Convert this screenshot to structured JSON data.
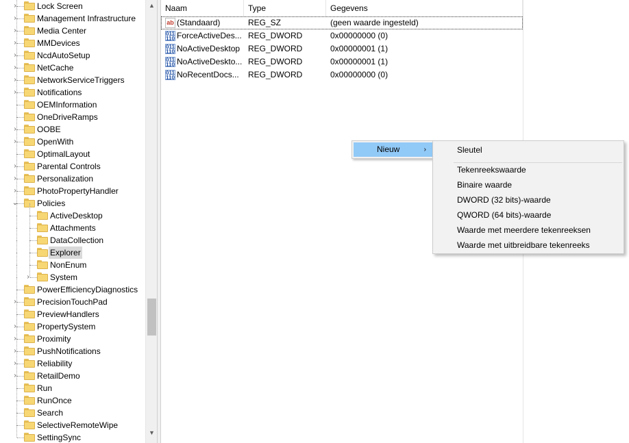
{
  "tree": {
    "items": [
      {
        "label": "Lock Screen",
        "expander": "›",
        "depth": 0
      },
      {
        "label": "Management Infrastructure",
        "expander": "›",
        "depth": 0
      },
      {
        "label": "Media Center",
        "expander": "›",
        "depth": 0
      },
      {
        "label": "MMDevices",
        "expander": "›",
        "depth": 0
      },
      {
        "label": "NcdAutoSetup",
        "expander": "›",
        "depth": 0
      },
      {
        "label": "NetCache",
        "expander": "›",
        "depth": 0
      },
      {
        "label": "NetworkServiceTriggers",
        "expander": "›",
        "depth": 0
      },
      {
        "label": "Notifications",
        "expander": "›",
        "depth": 0
      },
      {
        "label": "OEMInformation",
        "expander": "",
        "depth": 0
      },
      {
        "label": "OneDriveRamps",
        "expander": "",
        "depth": 0
      },
      {
        "label": "OOBE",
        "expander": "›",
        "depth": 0
      },
      {
        "label": "OpenWith",
        "expander": "›",
        "depth": 0
      },
      {
        "label": "OptimalLayout",
        "expander": "",
        "depth": 0
      },
      {
        "label": "Parental Controls",
        "expander": "›",
        "depth": 0
      },
      {
        "label": "Personalization",
        "expander": "›",
        "depth": 0
      },
      {
        "label": "PhotoPropertyHandler",
        "expander": "›",
        "depth": 0
      },
      {
        "label": "Policies",
        "expander": "⌄",
        "depth": 0
      },
      {
        "label": "ActiveDesktop",
        "expander": "",
        "depth": 1
      },
      {
        "label": "Attachments",
        "expander": "",
        "depth": 1
      },
      {
        "label": "DataCollection",
        "expander": "",
        "depth": 1
      },
      {
        "label": "Explorer",
        "expander": "",
        "depth": 1
      },
      {
        "label": "NonEnum",
        "expander": "",
        "depth": 1
      },
      {
        "label": "System",
        "expander": "›",
        "depth": 1
      },
      {
        "label": "PowerEfficiencyDiagnostics",
        "expander": "",
        "depth": 0
      },
      {
        "label": "PrecisionTouchPad",
        "expander": "›",
        "depth": 0
      },
      {
        "label": "PreviewHandlers",
        "expander": "",
        "depth": 0
      },
      {
        "label": "PropertySystem",
        "expander": "›",
        "depth": 0
      },
      {
        "label": "Proximity",
        "expander": "›",
        "depth": 0
      },
      {
        "label": "PushNotifications",
        "expander": "›",
        "depth": 0
      },
      {
        "label": "Reliability",
        "expander": "›",
        "depth": 0
      },
      {
        "label": "RetailDemo",
        "expander": "›",
        "depth": 0
      },
      {
        "label": "Run",
        "expander": "",
        "depth": 0
      },
      {
        "label": "RunOnce",
        "expander": "",
        "depth": 0
      },
      {
        "label": "Search",
        "expander": "",
        "depth": 0
      },
      {
        "label": "SelectiveRemoteWipe",
        "expander": "",
        "depth": 0
      },
      {
        "label": "SettingSync",
        "expander": "",
        "depth": 0
      }
    ],
    "selected_label": "Explorer",
    "scrollbar": {
      "up_arrow": "▲",
      "down_arrow": "▼"
    }
  },
  "values": {
    "columns": [
      "Naam",
      "Type",
      "Gegevens"
    ],
    "rows": [
      {
        "name": "(Standaard)",
        "type": "REG_SZ",
        "data": "(geen waarde ingesteld)",
        "icon": "string-value-icon",
        "glyph": "ab"
      },
      {
        "name": "ForceActiveDes...",
        "type": "REG_DWORD",
        "data": "0x00000000 (0)",
        "icon": "binary-value-icon",
        "glyph": "011 110"
      },
      {
        "name": "NoActiveDesktop",
        "type": "REG_DWORD",
        "data": "0x00000001 (1)",
        "icon": "binary-value-icon",
        "glyph": "011 110"
      },
      {
        "name": "NoActiveDeskto...",
        "type": "REG_DWORD",
        "data": "0x00000001 (1)",
        "icon": "binary-value-icon",
        "glyph": "011 110"
      },
      {
        "name": "NoRecentDocs...",
        "type": "REG_DWORD",
        "data": "0x00000000 (0)",
        "icon": "binary-value-icon",
        "glyph": "011 110"
      }
    ]
  },
  "context_menu": {
    "new_label": "Nieuw",
    "new_chevron": "›",
    "submenu": {
      "key_label": "Sleutel",
      "items": [
        "Tekenreekswaarde",
        "Binaire waarde",
        "DWORD (32 bits)-waarde",
        "QWORD (64 bits)-waarde",
        "Waarde met meerdere tekenreeksen",
        "Waarde met uitbreidbare tekenreeks"
      ]
    }
  },
  "colors": {
    "menu_highlight": "#91c9f7",
    "folder": "#f7d774",
    "selection": "#d9d9d9"
  }
}
